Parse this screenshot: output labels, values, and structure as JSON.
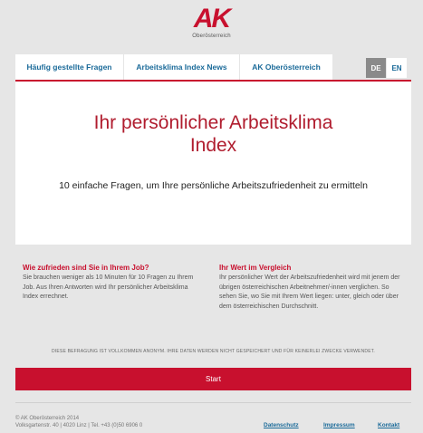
{
  "logo": {
    "mark": "AK",
    "sub": "Oberösterreich"
  },
  "nav": {
    "tabs": [
      {
        "label": "Häufig gestellte Fragen"
      },
      {
        "label": "Arbeitsklima Index News"
      },
      {
        "label": "AK Oberösterreich"
      }
    ],
    "languages": {
      "de": "DE",
      "en": "EN",
      "active": "DE"
    }
  },
  "hero": {
    "title_line1": "Ihr persönlicher Arbeitsklima",
    "title_line2": "Index",
    "subtitle": "10 einfache Fragen, um Ihre persönliche Arbeitszufriedenheit zu ermitteln"
  },
  "info": {
    "left": {
      "heading": "Wie zufrieden sind Sie in Ihrem Job?",
      "body": "Sie brauchen weniger als 10 Minuten für 10 Fragen zu Ihrem Job. Aus Ihren Antworten wird Ihr persönlicher Arbeitsklima Index errechnet."
    },
    "right": {
      "heading": "Ihr Wert im Vergleich",
      "body": "Ihr persönlicher Wert der Arbeitszufriedenheit wird mit jenem der übrigen österreichischen Arbeitnehmer/-innen verglichen. So sehen Sie, wo Sie mit Ihrem Wert liegen: unter, gleich oder über dem österreichischen Durchschnitt."
    }
  },
  "notice": "DIESE BEFRAGUNG IST VOLLKOMMEN ANONYM. IHRE DATEN WERDEN NICHT GESPEICHERT UND FÜR KEINERLEI ZWECKE VERWENDET.",
  "start_button": "Start",
  "footer": {
    "copyright": "© AK Oberösterreich 2014",
    "address": "Volksgartenstr. 40 | 4020 Linz | Tel. +43 (0)50 6906 0",
    "links": {
      "privacy": "Datenschutz",
      "imprint": "Impressum",
      "contact": "Kontakt"
    }
  },
  "colors": {
    "brand_red": "#c8102e",
    "link_blue": "#1a6a99",
    "background": "#e6e6e6"
  }
}
